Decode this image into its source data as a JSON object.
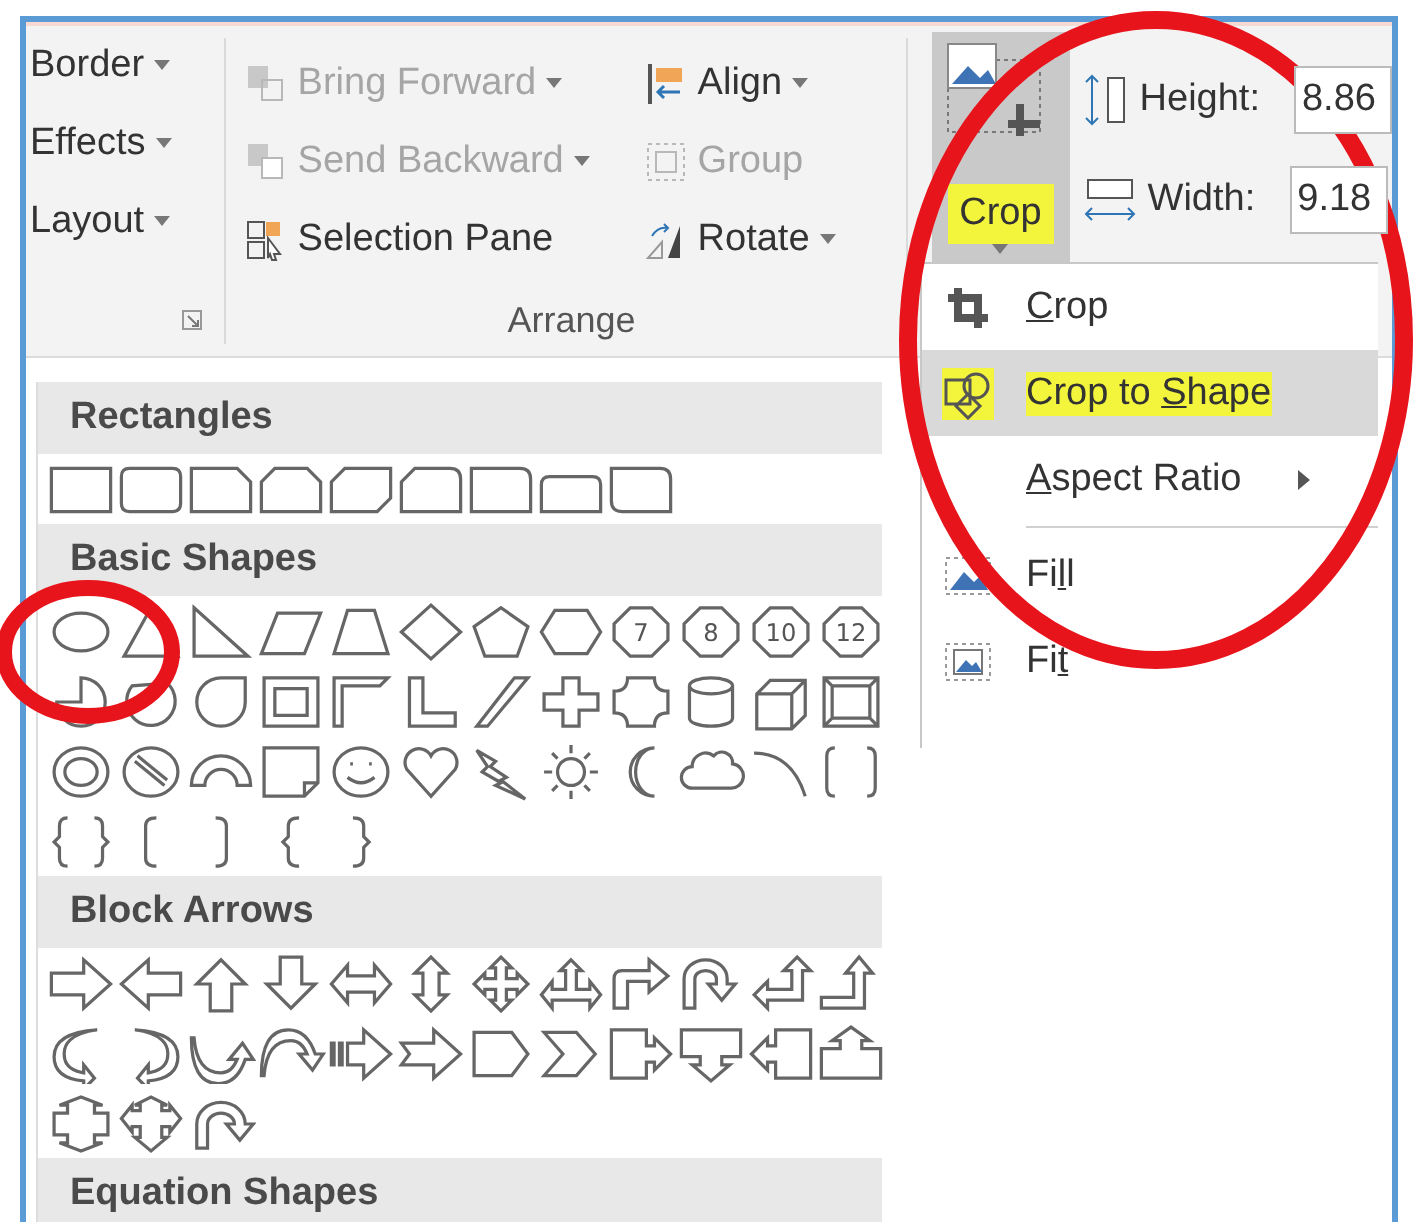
{
  "picture_format": {
    "buttons": [
      {
        "label": "Border"
      },
      {
        "label": "Effects"
      },
      {
        "label": "Layout"
      }
    ]
  },
  "arrange": {
    "title": "Arrange",
    "items": [
      {
        "label": "Bring Forward",
        "disabled": true
      },
      {
        "label": "Align",
        "disabled": false
      },
      {
        "label": "Send Backward",
        "disabled": true
      },
      {
        "label": "Group",
        "disabled": true
      },
      {
        "label": "Selection Pane",
        "disabled": false
      },
      {
        "label": "Rotate",
        "disabled": false
      }
    ]
  },
  "crop_button": {
    "label": "Crop",
    "highlighted": true
  },
  "size": {
    "height_label": "Height:",
    "height_value": "8.86",
    "width_label": "Width:",
    "width_value": "9.18"
  },
  "crop_menu": [
    {
      "key": "C",
      "after": "rop",
      "selected": false,
      "highlighted": false,
      "submenu": false
    },
    {
      "before": "Crop to ",
      "key": "S",
      "after": "hape",
      "selected": true,
      "highlighted": true,
      "submenu": false
    },
    {
      "key": "A",
      "after": "spect Ratio",
      "selected": false,
      "highlighted": false,
      "submenu": true
    },
    {
      "before": "Fi",
      "key": "l",
      "after": "l",
      "selected": false,
      "highlighted": false,
      "submenu": false
    },
    {
      "before": "Fi",
      "key": "t",
      "selected": false,
      "highlighted": false,
      "submenu": false
    }
  ],
  "shape_gallery": {
    "sections": [
      {
        "title": "Rectangles"
      },
      {
        "title": "Basic Shapes",
        "numbered_shapes": [
          "7",
          "8",
          "10",
          "12"
        ]
      },
      {
        "title": "Block Arrows"
      },
      {
        "title": "Equation Shapes"
      }
    ]
  }
}
